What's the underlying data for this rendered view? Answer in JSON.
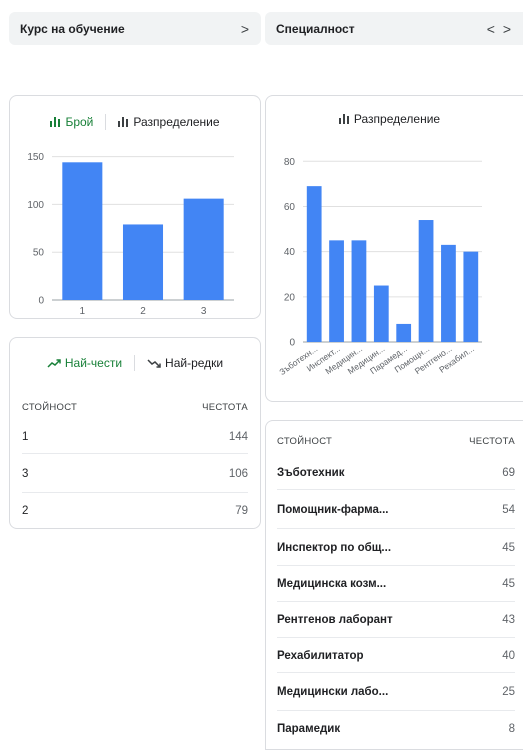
{
  "header_left": {
    "title": "Курс на обучение",
    "arrow": ">"
  },
  "header_right": {
    "title": "Специалност",
    "arrows": "< >"
  },
  "left_card": {
    "tab_count": "Брой",
    "tab_dist": "Разпределение",
    "active_tab": "Брой"
  },
  "right_card": {
    "tab_dist": "Разпределение"
  },
  "freq_card": {
    "tab_most": "Най-чести",
    "tab_least": "Най-редки",
    "col_value": "СТОЙНОСТ",
    "col_freq": "ЧЕСТОТА",
    "rows": [
      {
        "value": "1",
        "freq": "144"
      },
      {
        "value": "3",
        "freq": "106"
      },
      {
        "value": "2",
        "freq": "79"
      }
    ]
  },
  "right_table": {
    "col_value": "СТОЙНОСТ",
    "col_freq": "ЧЕСТОТА",
    "rows": [
      {
        "value": "Зъботехник",
        "freq": "69"
      },
      {
        "value": "Помощник-фарма...",
        "freq": "54"
      },
      {
        "value": "Инспектор по общ...",
        "freq": "45"
      },
      {
        "value": "Медицинска козм...",
        "freq": "45"
      },
      {
        "value": "Рентгенов лаборант",
        "freq": "43"
      },
      {
        "value": "Рехабилитатор",
        "freq": "40"
      },
      {
        "value": "Медицински лабо...",
        "freq": "25"
      },
      {
        "value": "Парамедик",
        "freq": "8"
      }
    ]
  },
  "colors": {
    "bar": "#4285f4",
    "active_tab": "#188038",
    "grid": "#e0e0e0"
  },
  "chart_data": [
    {
      "type": "bar",
      "categories": [
        "1",
        "2",
        "3"
      ],
      "values": [
        144,
        79,
        106
      ],
      "ylim": [
        0,
        160
      ],
      "yticks": [
        "0",
        "50",
        "100",
        "150"
      ],
      "title": "",
      "xlabel": "",
      "ylabel": ""
    },
    {
      "type": "bar",
      "categories": [
        "Зъботехн...",
        "Инспект...",
        "Медицин...",
        "Медицин...",
        "Парамед...",
        "Помощн...",
        "Рентгено...",
        "Рехабил..."
      ],
      "values": [
        69,
        45,
        45,
        25,
        8,
        54,
        43,
        40
      ],
      "ylim": [
        0,
        85
      ],
      "yticks": [
        "0",
        "20",
        "40",
        "60",
        "80"
      ],
      "title": "",
      "xlabel": "",
      "ylabel": ""
    }
  ]
}
